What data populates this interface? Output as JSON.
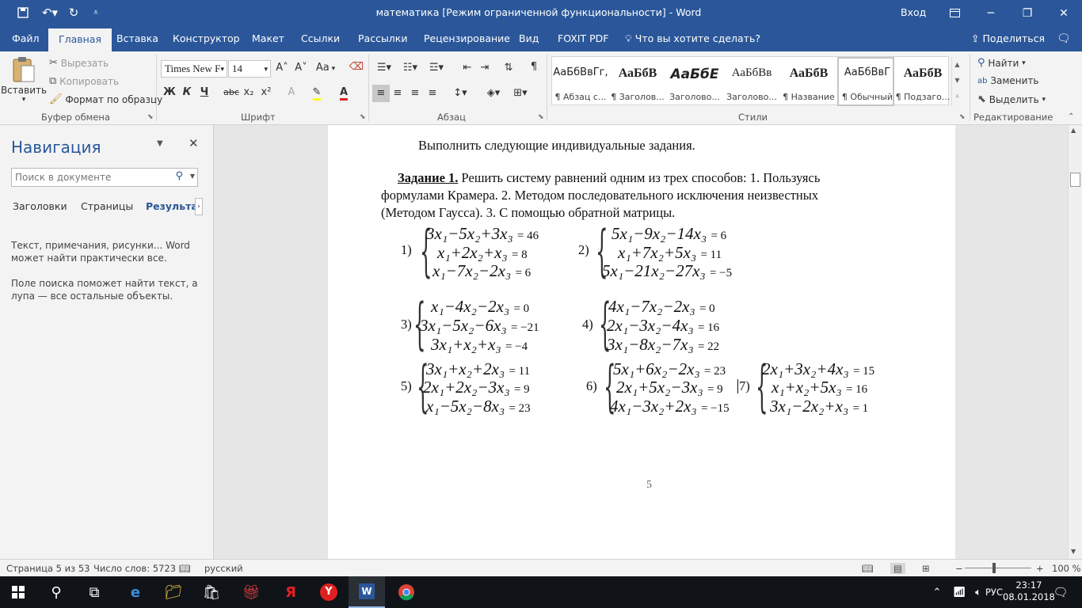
{
  "window": {
    "title": "математика [Режим ограниченной функциональности]  -  Word",
    "signin": "Вход",
    "qa_icons": [
      "save-icon",
      "undo-icon",
      "redo-icon",
      "customize-icon"
    ]
  },
  "tabs": [
    "Файл",
    "Главная",
    "Вставка",
    "Конструктор",
    "Макет",
    "Ссылки",
    "Рассылки",
    "Рецензирование",
    "Вид",
    "FOXIT PDF"
  ],
  "tell_me": "Что вы хотите сделать?",
  "share": "Поделиться",
  "clipboard": {
    "paste": "Вставить",
    "cut": "Вырезать",
    "copy": "Копировать",
    "format_painter": "Формат по образцу",
    "label": "Буфер обмена"
  },
  "font": {
    "name": "Times New F",
    "size": "14",
    "label": "Шрифт",
    "bold": "Ж",
    "italic": "К",
    "underline": "Ч",
    "strike": "abc",
    "subscript": "x₂",
    "superscript": "x²",
    "grow": "A˄",
    "shrink": "A˅",
    "case": "Aa"
  },
  "paragraph": {
    "label": "Абзац"
  },
  "styles": {
    "label": "Стили",
    "items": [
      {
        "preview": "АаБбВвГг,",
        "name": "¶ Абзац с..."
      },
      {
        "preview": "АаБбВ",
        "name": "¶ Заголов..."
      },
      {
        "preview": "АаБбЕ",
        "name": "Заголово..."
      },
      {
        "preview": "АаБбВв",
        "name": "Заголово..."
      },
      {
        "preview": "АаБбВ",
        "name": "¶ Название"
      },
      {
        "preview": "АаБбВвГ",
        "name": "¶ Обычный"
      },
      {
        "preview": "АаБбВ",
        "name": "¶ Подзаго..."
      }
    ]
  },
  "editing": {
    "find": "Найти",
    "replace": "Заменить",
    "select": "Выделить",
    "label": "Редактирование"
  },
  "nav": {
    "title": "Навигация",
    "search_placeholder": "Поиск в документе",
    "tabs": [
      "Заголовки",
      "Страницы",
      "Результать"
    ],
    "text1": "Текст, примечания, рисунки... Word может найти практически все.",
    "text2": "Поле поиска поможет найти текст, а лупа — все остальные объекты."
  },
  "doc": {
    "intro": "Выполнить следующие индивидуальные задания.",
    "task_label": "Задание 1.",
    "task_line1": " Решить систему равнений одним из трех способов: 1. Пользуясь",
    "task_line2": "формулами Крамера. 2. Методом последовательного исключения неизвестных",
    "task_line3": "(Методом Гаусса). 3. С помощью обратной матрицы.",
    "page_number": "5",
    "systems": [
      {
        "num": "1)",
        "eqs": [
          [
            "3x₁−5x₂+3x₃",
            "= 46"
          ],
          [
            "x₁+2x₂+x₃",
            "= 8"
          ],
          [
            "x₁−7x₂−2x₃",
            "= 6"
          ]
        ]
      },
      {
        "num": "2)",
        "eqs": [
          [
            "5x₁−9x₂−14x₃",
            "= 6"
          ],
          [
            "x₁+7x₂+5x₃",
            "= 11"
          ],
          [
            "5x₁−21x₂−27x₃",
            "= −5"
          ]
        ]
      },
      {
        "num": "3)",
        "eqs": [
          [
            "x₁−4x₂−2x₃",
            "= 0"
          ],
          [
            "3x₁−5x₂−6x₃",
            "= −21"
          ],
          [
            "3x₁+x₂+x₃",
            "= −4"
          ]
        ]
      },
      {
        "num": "4)",
        "eqs": [
          [
            "4x₁−7x₂−2x₃",
            "= 0"
          ],
          [
            "2x₁−3x₂−4x₃",
            "= 16"
          ],
          [
            "3x₁−8x₂−7x₃",
            "= 22"
          ]
        ]
      },
      {
        "num": "5)",
        "eqs": [
          [
            "3x₁+x₂+2x₃",
            "= 11"
          ],
          [
            "2x₁+2x₂−3x₃",
            "= 9"
          ],
          [
            "x₁−5x₂−8x₃",
            "= 23"
          ]
        ]
      },
      {
        "num": "6)",
        "eqs": [
          [
            "5x₁+6x₂−2x₃",
            "= 23"
          ],
          [
            "2x₁+5x₂−3x₃",
            "= 9"
          ],
          [
            "4x₁−3x₂+2x₃",
            "= −15"
          ]
        ]
      },
      {
        "num": "7)",
        "eqs": [
          [
            "2x₁+3x₂+4x₃",
            "= 15"
          ],
          [
            "x₁+x₂+5x₃",
            "= 16"
          ],
          [
            "3x₁−2x₂+x₃",
            "= 1"
          ]
        ]
      }
    ]
  },
  "status": {
    "page": "Страница 5 из 53",
    "words": "Число слов: 5723",
    "lang": "русский",
    "zoom": "100 %"
  },
  "taskbar": {
    "lang": "РУС",
    "time": "23:17",
    "date": "08.01.2018"
  }
}
